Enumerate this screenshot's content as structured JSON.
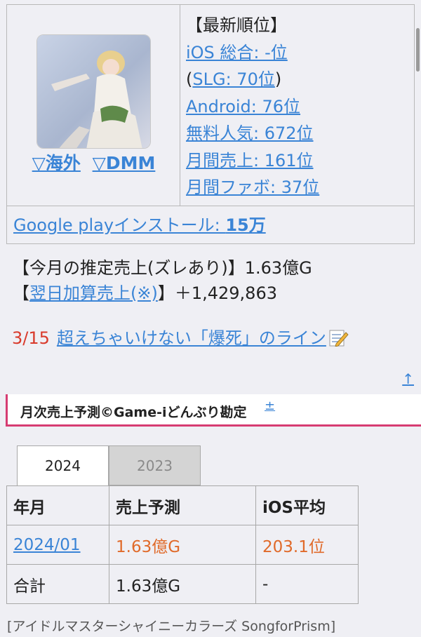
{
  "rankings": {
    "heading": "【最新順位】",
    "ios_total": "iOS 総合: -位",
    "slg_prefix": "(",
    "slg": "SLG: 70位",
    "slg_suffix": ")",
    "android": "Android: 76位",
    "free_popular": "無料人気: 672位",
    "monthly_sales": "月間売上: 161位",
    "monthly_fav": "月間ファボ: 37位",
    "overseas_link": "▽海外",
    "dmm_link": "▽DMM",
    "gplay_label": "Google playインストール: ",
    "gplay_value": "15万"
  },
  "sales": {
    "estimate_label": "【今月の推定売上(ズレあり)】1.63億G",
    "next_day_open": "【",
    "next_day_link": "翌日加算売上(※)",
    "next_day_close": "】＋1,429,863"
  },
  "news": {
    "date": "3/15",
    "headline": "超えちゃいけない「爆死」のライン"
  },
  "up_arrow": "↑",
  "section": {
    "title": "月次売上予測©Game-iどんぶり勘定",
    "plus": "±"
  },
  "tabs": [
    "2024",
    "2023"
  ],
  "table": {
    "headers": [
      "年月",
      "売上予測",
      "iOS平均"
    ],
    "rows": [
      [
        "2024/01",
        "1.63億G",
        "203.1位"
      ],
      [
        "合計",
        "1.63億G",
        "-"
      ]
    ]
  },
  "footer_tag": "[アイドルマスターシャイニーカラーズ SongforPrism]",
  "colors": {
    "link": "#3a84d6",
    "accent_pink": "#d63c72",
    "date_red": "#d93a2b",
    "value_orange": "#e06a2a"
  }
}
